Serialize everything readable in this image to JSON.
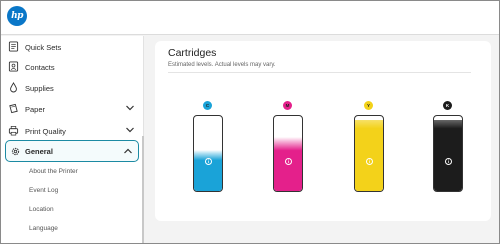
{
  "brand": {
    "logo_text": "hp",
    "color": "#0a77c8"
  },
  "sidebar": {
    "items": [
      {
        "label": "Quick Sets",
        "icon": "quick-sets-icon"
      },
      {
        "label": "Contacts",
        "icon": "contacts-icon"
      },
      {
        "label": "Supplies",
        "icon": "droplet-icon"
      },
      {
        "label": "Paper",
        "icon": "paper-icon",
        "expandable": true
      },
      {
        "label": "Print Quality",
        "icon": "print-quality-icon",
        "expandable": true
      },
      {
        "label": "General",
        "icon": "gear-icon",
        "expandable": true,
        "expanded": true,
        "selected": true
      }
    ],
    "sub_items": [
      "About the Printer",
      "Event Log",
      "Location",
      "Language"
    ],
    "accent": "#1c8aa3"
  },
  "main": {
    "title": "Cartridges",
    "subtitle": "Estimated levels. Actual levels may vary.",
    "cartridges": [
      {
        "badge": "C",
        "color": "#1aa3d8",
        "level": 0.55
      },
      {
        "badge": "M",
        "color": "#e4208b",
        "level": 0.72
      },
      {
        "badge": "Y",
        "color": "#f3d21a",
        "level": 0.95
      },
      {
        "badge": "K",
        "color": "#1c1c1c",
        "level": 0.95
      }
    ],
    "info_glyph": "i"
  }
}
